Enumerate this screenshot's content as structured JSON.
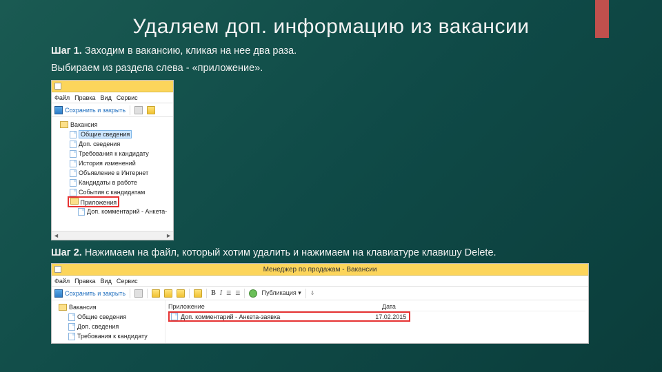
{
  "slide": {
    "title": "Удаляем доп. информацию из вакансии",
    "step1_label": "Шаг 1.",
    "step1_text_a": " Заходим в вакансию, кликая на нее два раза.",
    "step1_text_b": "Выбираем из раздела слева - «приложение».",
    "step2_label": "Шаг 2.",
    "step2_text": " Нажимаем на файл, который хотим удалить и нажимаем на клавиатуре клавишу Delete."
  },
  "shot1": {
    "menu": {
      "file": "Файл",
      "edit": "Правка",
      "view": "Вид",
      "service": "Сервис"
    },
    "toolbar": {
      "save_close": "Сохранить и закрыть"
    },
    "tree": {
      "root": "Вакансия",
      "items": [
        "Общие сведения",
        "Доп. сведения",
        "Требования к кандидату",
        "История изменений",
        "Объявление в Интернет",
        "Кандидаты в работе",
        "События с кандидатам",
        "Приложения",
        "Доп. комментарий - Анкета-"
      ]
    }
  },
  "shot2": {
    "title": "Менеджер по продажам - Вакансии",
    "menu": {
      "file": "Файл",
      "edit": "Правка",
      "view": "Вид",
      "service": "Сервис"
    },
    "toolbar": {
      "save_close": "Сохранить и закрыть",
      "pub": "Публикация",
      "b": "B",
      "i": "I"
    },
    "tree": {
      "root": "Вакансия",
      "items": [
        "Общие сведения",
        "Доп. сведения",
        "Требования к кандидату"
      ]
    },
    "cols": {
      "name": "Приложение",
      "date": "Дата"
    },
    "file": {
      "name": "Доп. комментарий - Анкета-заявка",
      "date": "17.02.2015"
    }
  }
}
